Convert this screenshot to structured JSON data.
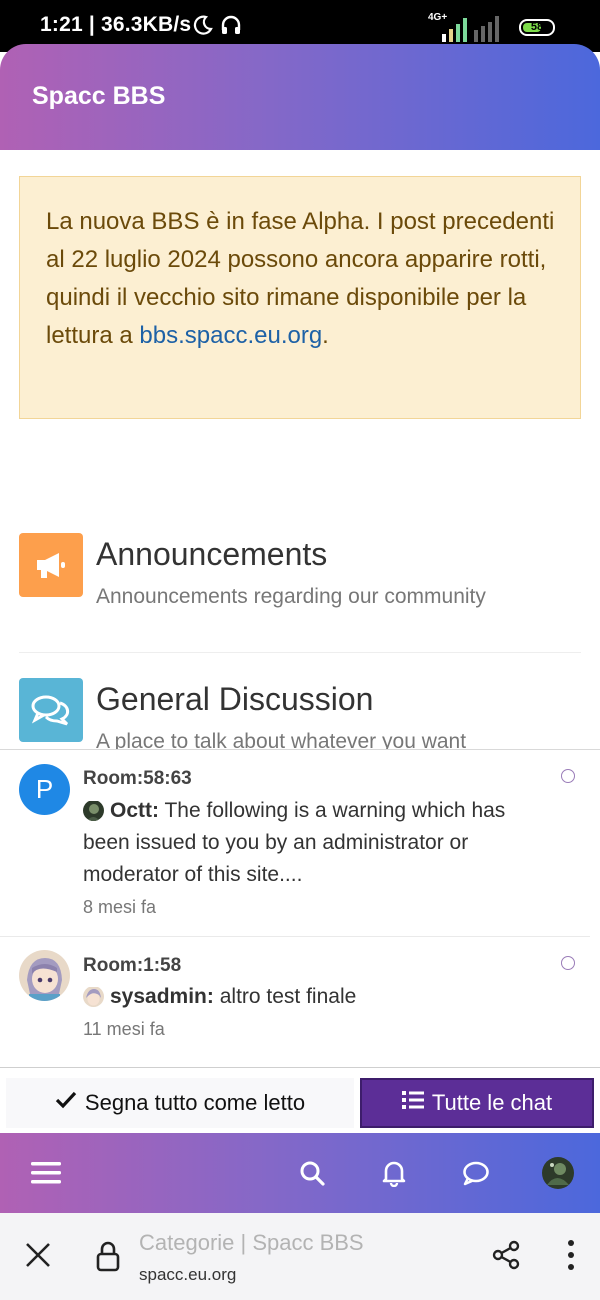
{
  "status_bar": {
    "time": "1:21 | 36.3KB/s",
    "network": "4G+",
    "battery": "58"
  },
  "header": {
    "title": "Spacc BBS"
  },
  "alert": {
    "text": "La nuova BBS è in fase Alpha. I post precedenti al 22 luglio 2024 possono ancora apparire rotti, quindi il vecchio sito rimane disponibile per la lettura a ",
    "link": "bbs.spacc.eu.org",
    "suffix": "."
  },
  "categories": [
    {
      "title": "Announcements",
      "description": "Announcements regarding our community",
      "icon": "bullhorn-icon",
      "color": "#fd9f4c"
    },
    {
      "title": "General Discussion",
      "description": "A place to talk about whatever you want",
      "icon": "comments-icon",
      "color": "#59b5d6"
    }
  ],
  "chats": [
    {
      "avatar_letter": "P",
      "room": "Room:58:63",
      "author": "Octt:",
      "message": "The following is a warning which has been issued to you by an administrator or moderator of this site....",
      "time": "8 mesi fa"
    },
    {
      "room": "Room:1:58",
      "author": "sysadmin:",
      "message": "altro test finale",
      "time": "11 mesi fa"
    }
  ],
  "actions": {
    "mark_all_read": "Segna tutto come letto",
    "all_chats": "Tutte le chat"
  },
  "browser": {
    "tab_title": "Categorie | Spacc BBS",
    "url": "spacc.eu.org"
  },
  "colors": {
    "brand_gradient_start": "#b061b4",
    "brand_gradient_end": "#4c68dc",
    "chat_button": "#5c2e97",
    "alert_bg": "#fcefd2"
  }
}
